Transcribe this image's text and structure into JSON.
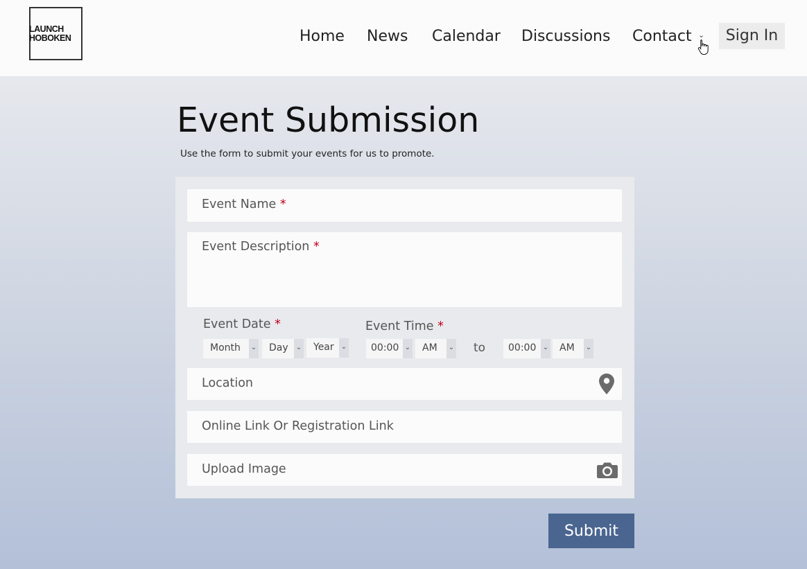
{
  "header": {
    "logo": {
      "line1": "LAUNCH",
      "line2": "HOBOKEN"
    },
    "nav": [
      {
        "label": "Home"
      },
      {
        "label": "News"
      },
      {
        "label": "Calendar"
      },
      {
        "label": "Discussions"
      },
      {
        "label": "Contact"
      }
    ],
    "sign_in": "Sign In"
  },
  "page": {
    "title": "Event Submission",
    "subtitle": "Use the form to submit your events for us to promote."
  },
  "form": {
    "event_name": {
      "label": "Event Name",
      "required": "*"
    },
    "event_description": {
      "label": "Event Description",
      "required": "*"
    },
    "event_date": {
      "label": "Event Date",
      "required": "*",
      "month": "Month",
      "day": "Day",
      "year": "Year"
    },
    "event_time": {
      "label": "Event Time",
      "required": "*",
      "start_time": "00:00",
      "start_period": "AM",
      "to": "to",
      "end_time": "00:00",
      "end_period": "AM"
    },
    "location": {
      "label": "Location",
      "icon": "map-pin-icon"
    },
    "online_link": {
      "label": "Online Link Or Registration Link"
    },
    "upload_image": {
      "label": "Upload Image",
      "icon": "camera-icon"
    },
    "submit": "Submit"
  },
  "colors": {
    "accent": "#4a6590",
    "required": "#c0001e",
    "header_bg": "#fbfbfb",
    "form_bg": "#e9eaed"
  }
}
